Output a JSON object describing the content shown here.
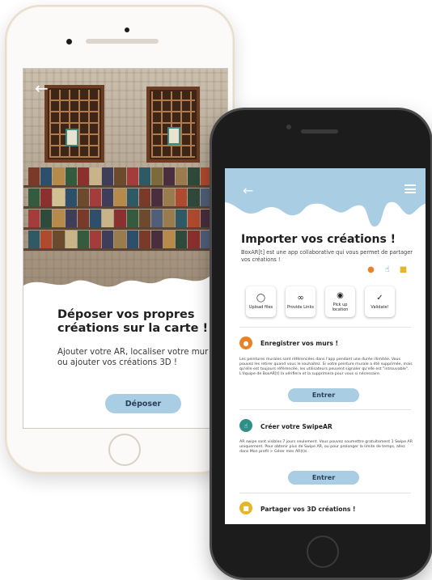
{
  "phone_left": {
    "title": "Déposer vos propres créations sur la carte !",
    "description": "Ajouter votre AR, localiser votre mur ou ajouter vos créations 3D !",
    "button_label": "Déposer",
    "icons": {
      "back": "back-arrow-icon",
      "home": "home-button-icon"
    }
  },
  "phone_right": {
    "title": "Importer vos créations !",
    "description": "BoxAR[t] est une app collaborative qui vous permet de partager vos créations !",
    "actions": [
      {
        "icon": "camera-icon",
        "label": "Upload files"
      },
      {
        "icon": "paperclip-icon",
        "label": "Provide Links"
      },
      {
        "icon": "location-pin-icon",
        "label": "Pick up location"
      },
      {
        "icon": "check-icon",
        "label": "Validate!"
      }
    ],
    "sections": [
      {
        "title": "Enregistrer vos murs !",
        "text": "Les peintures murales sont référencées dans l'app pendant une durée illimitée. Vous pouvez les retirer quand vous le souhaitez. Si votre peinture murale a été supprimée, mais qu'elle est toujours référencée, les utilisateurs peuvent signaler qu'elle est \"introuvable\". L'équipe de BoxAR[t] la vérifiera et la supprimera pour vous si nécessaire.",
        "button_label": "Entrer",
        "icon": "location-pin-icon",
        "color": "#e8822a"
      },
      {
        "title": "Créer votre SwipeAR",
        "text": "AR swipe sont visibles 7 jours seulement. Vous pouvez soumettre gratuitement 1 Swipe AR uniquement. Pour obtenir plus de Swipe AR, ou pour prolonger la limite de temps, allez dans Mon profil > Gérer mes AR(t)s.",
        "button_label": "Entrer",
        "icon": "swipe-icon",
        "color": "#2f8f86"
      },
      {
        "title": "Partager vos 3D créations !",
        "icon": "cube-icon",
        "color": "#e7b52a"
      }
    ],
    "colors": {
      "header": "#a9cde3",
      "button": "#a9cde3"
    }
  }
}
